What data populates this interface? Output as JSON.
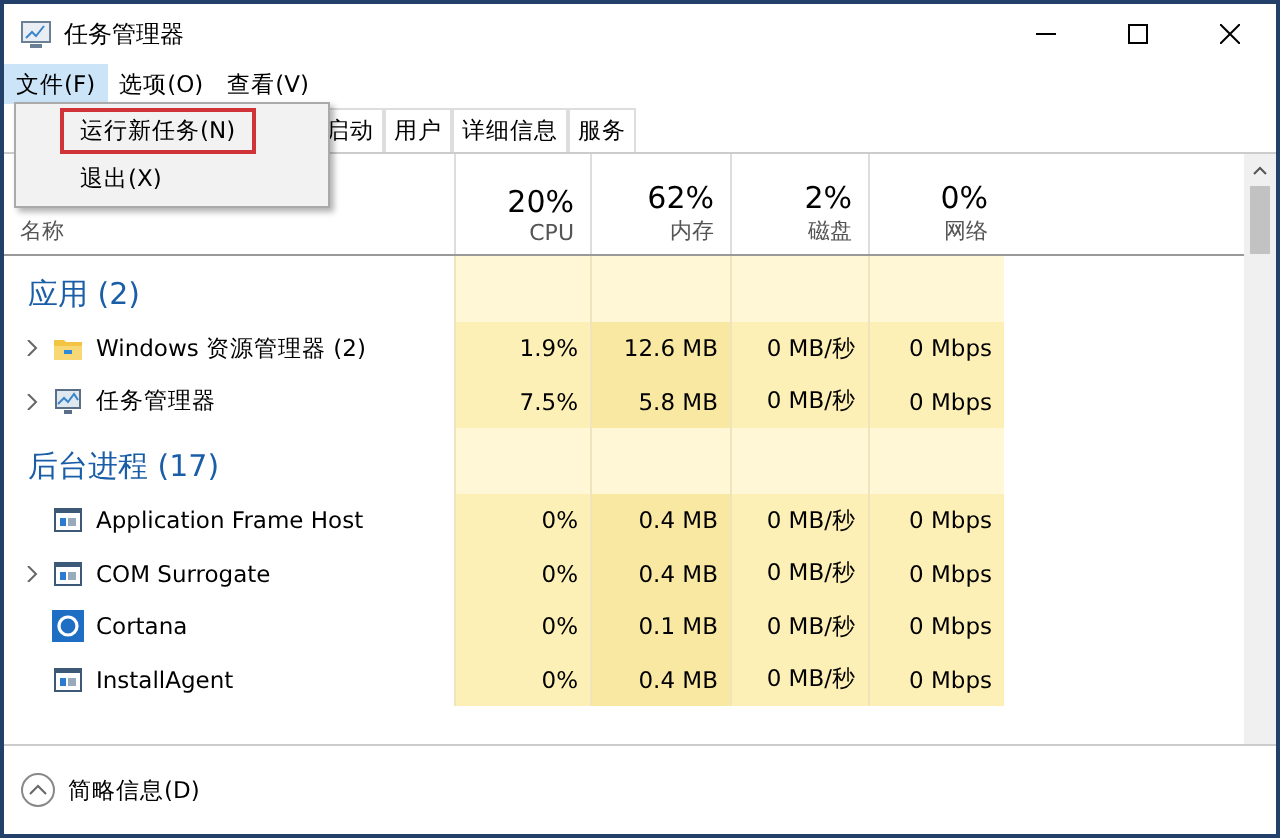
{
  "window": {
    "title": "任务管理器"
  },
  "menu_bar": [
    {
      "label": "文件(F)",
      "selected": true
    },
    {
      "label": "选项(O)",
      "selected": false
    },
    {
      "label": "查看(V)",
      "selected": false
    }
  ],
  "file_menu": [
    {
      "label": "运行新任务(N)",
      "highlighted": true
    },
    {
      "label": "退出(X)",
      "highlighted": false
    }
  ],
  "tabs": [
    {
      "label": "启动",
      "selected": false
    },
    {
      "label": "用户",
      "selected": false
    },
    {
      "label": "详细信息",
      "selected": false
    },
    {
      "label": "服务",
      "selected": false
    }
  ],
  "columns": [
    {
      "label": "名称"
    },
    {
      "percent": "20%",
      "label": "CPU"
    },
    {
      "percent": "62%",
      "label": "内存"
    },
    {
      "percent": "2%",
      "label": "磁盘"
    },
    {
      "percent": "0%",
      "label": "网络"
    }
  ],
  "groups": [
    {
      "title": "应用 (2)",
      "rows": [
        {
          "name": "Windows 资源管理器 (2)",
          "kind": "folder",
          "expandable": true,
          "cpu": "1.9%",
          "memory": "12.6 MB",
          "disk": "0 MB/秒",
          "network": "0 Mbps"
        },
        {
          "name": "任务管理器",
          "kind": "monitor",
          "expandable": true,
          "cpu": "7.5%",
          "memory": "5.8 MB",
          "disk": "0 MB/秒",
          "network": "0 Mbps"
        }
      ]
    },
    {
      "title": "后台进程 (17)",
      "rows": [
        {
          "name": "Application Frame Host",
          "kind": "window",
          "expandable": false,
          "cpu": "0%",
          "memory": "0.4 MB",
          "disk": "0 MB/秒",
          "network": "0 Mbps"
        },
        {
          "name": "COM Surrogate",
          "kind": "window",
          "expandable": true,
          "cpu": "0%",
          "memory": "0.4 MB",
          "disk": "0 MB/秒",
          "network": "0 Mbps"
        },
        {
          "name": "Cortana",
          "kind": "ring",
          "expandable": false,
          "cpu": "0%",
          "memory": "0.1 MB",
          "disk": "0 MB/秒",
          "network": "0 Mbps"
        },
        {
          "name": "InstallAgent",
          "kind": "window",
          "expandable": false,
          "cpu": "0%",
          "memory": "0.4 MB",
          "disk": "0 MB/秒",
          "network": "0 Mbps"
        }
      ]
    }
  ],
  "footer": {
    "label": "简略信息(D)"
  }
}
